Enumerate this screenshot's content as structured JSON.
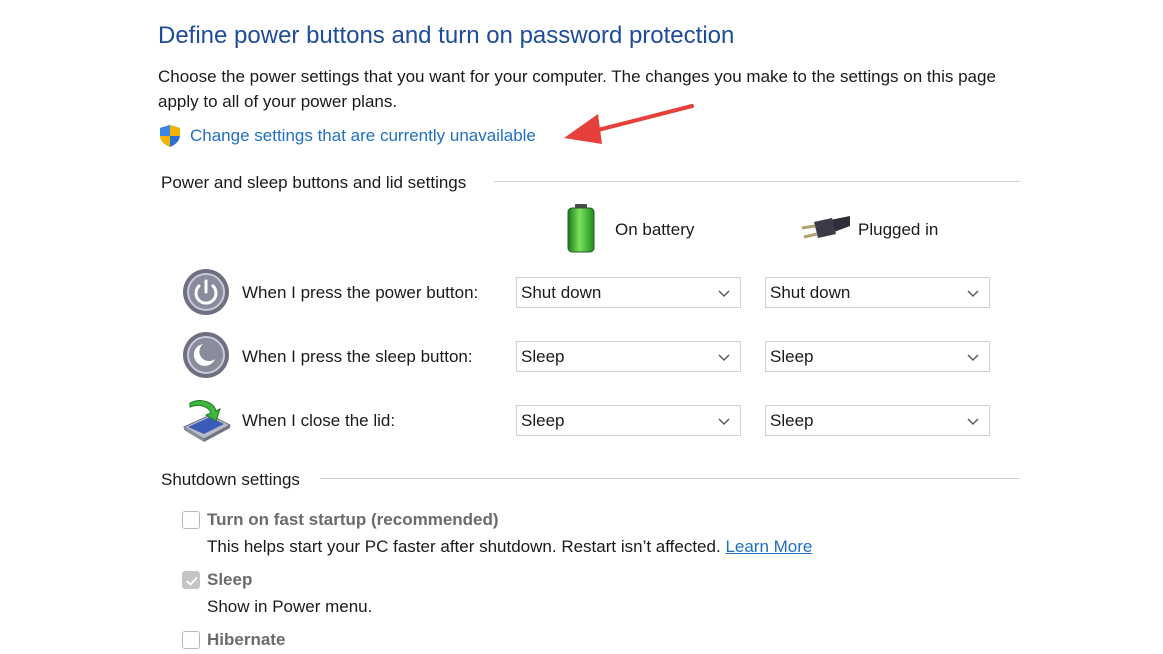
{
  "page": {
    "title": "Define power buttons and turn on password protection",
    "description": "Choose the power settings that you want for your computer. The changes you make to the settings on this page apply to all of your power plans.",
    "change_link": "Change settings that are currently unavailable"
  },
  "power_section": {
    "heading": "Power and sleep buttons and lid settings",
    "columns": {
      "battery": "On battery",
      "plugged": "Plugged in"
    },
    "rows": [
      {
        "label": "When I press the power button:",
        "battery": "Shut down",
        "plugged": "Shut down",
        "icon": "power-icon"
      },
      {
        "label": "When I press the sleep button:",
        "battery": "Sleep",
        "plugged": "Sleep",
        "icon": "sleep-icon"
      },
      {
        "label": "When I close the lid:",
        "battery": "Sleep",
        "plugged": "Sleep",
        "icon": "laptop-lid-icon"
      }
    ]
  },
  "shutdown_section": {
    "heading": "Shutdown settings",
    "options": [
      {
        "label": "Turn on fast startup (recommended)",
        "description": "This helps start your PC faster after shutdown. Restart isn’t affected.",
        "link": "Learn More",
        "checked": false
      },
      {
        "label": "Sleep",
        "description": "Show in Power menu.",
        "checked": true
      },
      {
        "label": "Hibernate",
        "checked": false
      }
    ]
  },
  "colors": {
    "title": "#1e4c9a",
    "link": "#1f6fc5",
    "annotation_arrow": "#e5403b"
  }
}
